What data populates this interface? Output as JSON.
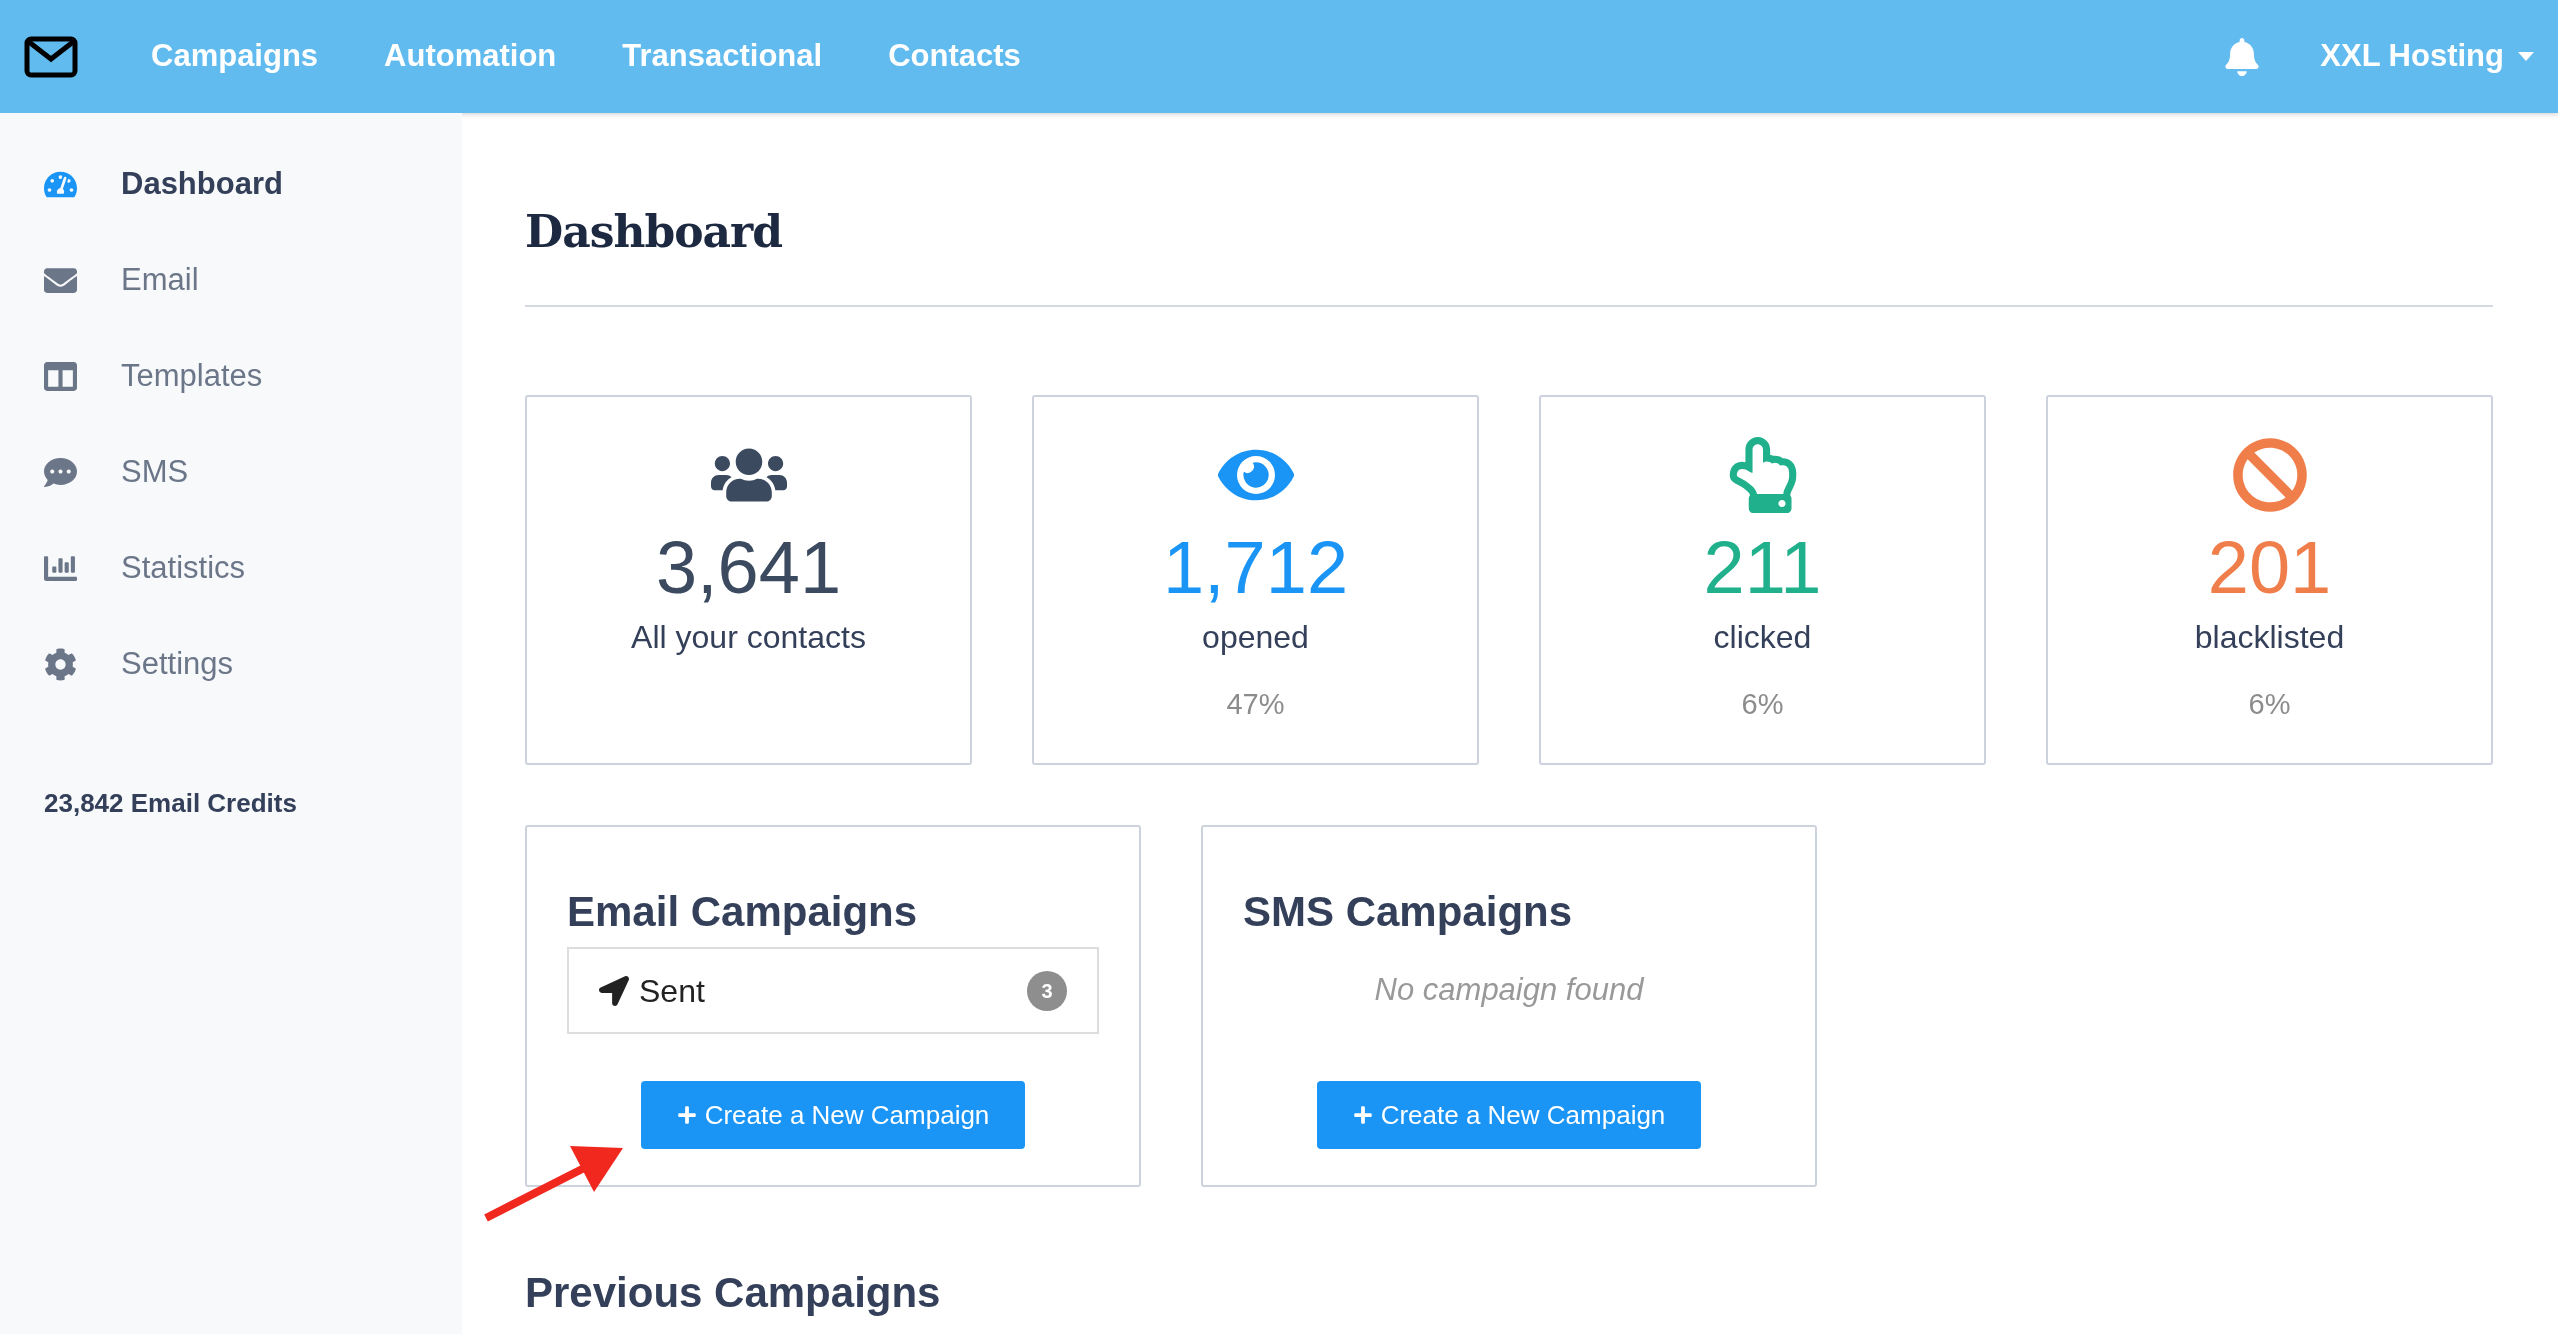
{
  "nav": {
    "items": [
      {
        "label": "Campaigns"
      },
      {
        "label": "Automation"
      },
      {
        "label": "Transactional"
      },
      {
        "label": "Contacts"
      }
    ],
    "account": "XXL Hosting"
  },
  "sidebar": {
    "items": [
      {
        "label": "Dashboard",
        "selected": true
      },
      {
        "label": "Email",
        "selected": false
      },
      {
        "label": "Templates",
        "selected": false
      },
      {
        "label": "SMS",
        "selected": false
      },
      {
        "label": "Statistics",
        "selected": false
      },
      {
        "label": "Settings",
        "selected": false
      }
    ],
    "credits": "23,842 Email Credits"
  },
  "page_title": "Dashboard",
  "stats": [
    {
      "value": "3,641",
      "label": "All your contacts",
      "color": "#3b4a5f"
    },
    {
      "value": "1,712",
      "label": "opened",
      "percent": "47%",
      "color": "#1a95f5"
    },
    {
      "value": "211",
      "label": "clicked",
      "percent": "6%",
      "color": "#20b08c"
    },
    {
      "value": "201",
      "label": "blacklisted",
      "percent": "6%",
      "color": "#ef7e4b"
    }
  ],
  "campaign_cards": [
    {
      "kind": "list",
      "title": "Email Campaigns",
      "entries": [
        {
          "label": "Sent",
          "count": "3"
        }
      ],
      "button": "Create a New Campaign"
    },
    {
      "kind": "empty",
      "title": "SMS Campaigns",
      "message": "No campaign found",
      "button": "Create a New Campaign"
    }
  ],
  "previous_heading": "Previous Campaigns"
}
